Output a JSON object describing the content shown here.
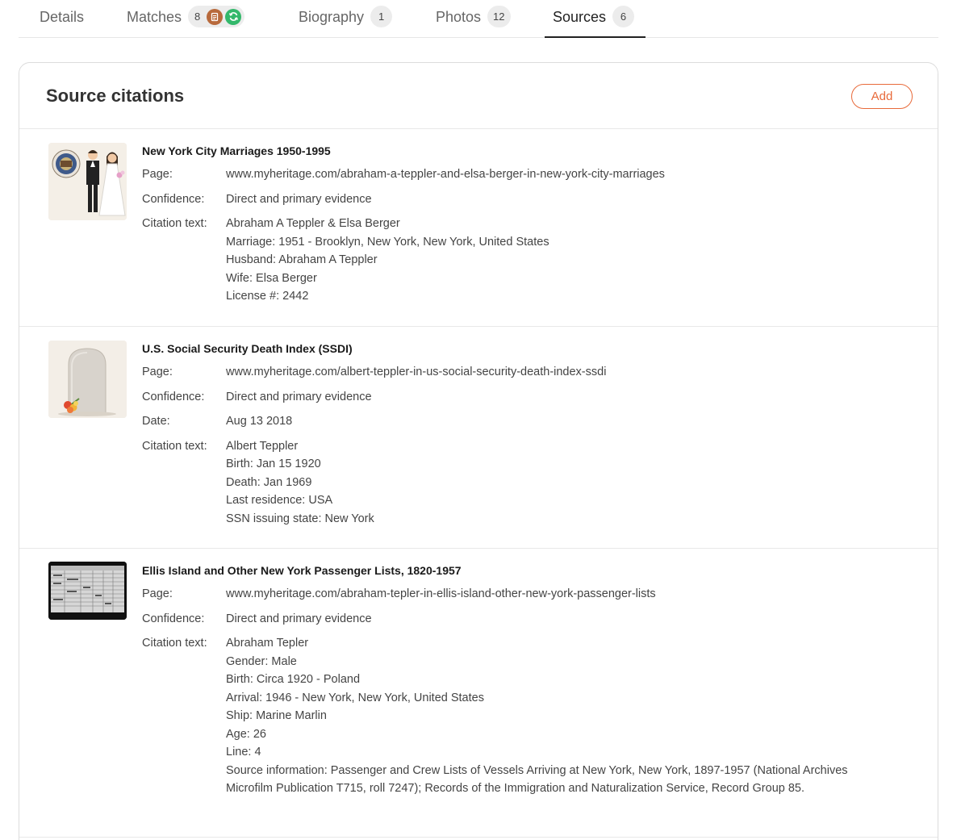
{
  "tabs": [
    {
      "label": "Details"
    },
    {
      "label": "Matches",
      "count": "8"
    },
    {
      "label": "Biography",
      "count": "1"
    },
    {
      "label": "Photos",
      "count": "12"
    },
    {
      "label": "Sources",
      "count": "6"
    }
  ],
  "card": {
    "title": "Source citations",
    "add_label": "Add"
  },
  "labels": {
    "page": "Page:",
    "confidence": "Confidence:",
    "date": "Date:",
    "citation_text": "Citation text:"
  },
  "citations": [
    {
      "title": "New York City Marriages 1950-1995",
      "page": "www.myheritage.com/abraham-a-teppler-and-elsa-berger-in-new-york-city-marriages",
      "confidence": "Direct and primary evidence",
      "lines": [
        "Abraham A Teppler & Elsa Berger",
        "Marriage: 1951 - Brooklyn, New York, New York, United States",
        "Husband: Abraham A Teppler",
        "Wife: Elsa Berger",
        "License #: 2442"
      ]
    },
    {
      "title": "U.S. Social Security Death Index (SSDI)",
      "page": "www.myheritage.com/albert-teppler-in-us-social-security-death-index-ssdi",
      "confidence": "Direct and primary evidence",
      "date": "Aug 13 2018",
      "lines": [
        "Albert Teppler",
        "Birth: Jan 15 1920",
        "Death: Jan 1969",
        "Last residence: USA",
        "SSN issuing state: New York"
      ]
    },
    {
      "title": "Ellis Island and Other New York Passenger Lists, 1820-1957",
      "page": "www.myheritage.com/abraham-tepler-in-ellis-island-other-new-york-passenger-lists",
      "confidence": "Direct and primary evidence",
      "lines": [
        "Abraham Tepler",
        "Gender: Male",
        "Birth: Circa 1920 - Poland",
        "Arrival: 1946 - New York, New York, United States",
        "Ship: Marine Marlin",
        "Age: 26",
        "Line: 4",
        "Source information: Passenger and Crew Lists of Vessels Arriving at New York, New York, 1897-1957 (National Archives Microfilm Publication T715, roll 7247); Records of the Immigration and Naturalization Service, Record Group 85."
      ]
    }
  ]
}
